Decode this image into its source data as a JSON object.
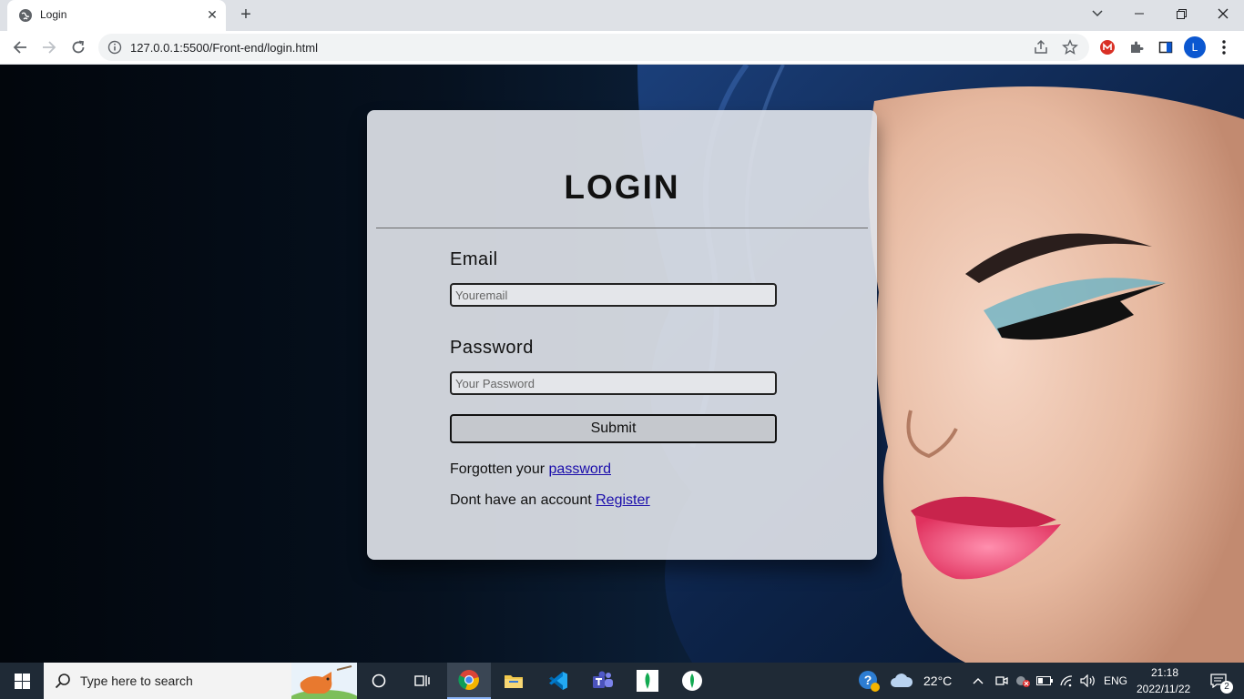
{
  "browser": {
    "tab_title": "Login",
    "url": "127.0.0.1:5500/Front-end/login.html",
    "profile_initial": "L"
  },
  "login": {
    "heading": "LOGIN",
    "email_label": "Email",
    "email_placeholder": "Youremail",
    "password_label": "Password",
    "password_placeholder": "Your Password",
    "submit_label": "Submit",
    "forgot_prefix": "Forgotten your",
    "forgot_link": "password",
    "register_prefix": "Dont have an account",
    "register_link": "Register"
  },
  "taskbar": {
    "search_placeholder": "Type here to search",
    "weather": "22°C",
    "language": "ENG",
    "time": "21:18",
    "date": "2022/11/22",
    "notification_count": "2"
  },
  "colors": {
    "link": "#1a0dab",
    "chrome_tabbar": "#dee1e6",
    "taskbar": "#1f2a36",
    "profile_avatar": "#0b57d0"
  }
}
